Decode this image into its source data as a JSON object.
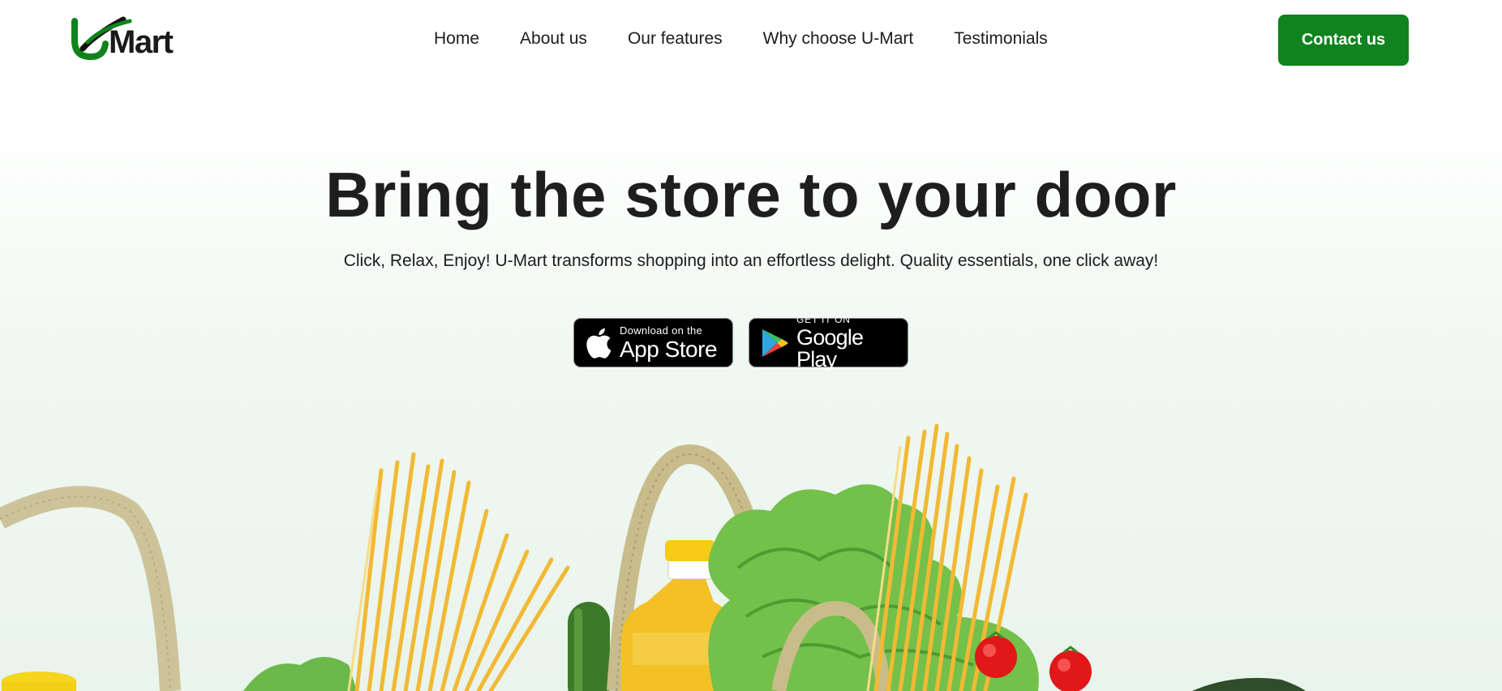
{
  "header": {
    "logo": {
      "text": "Mart",
      "icon": "u-checkmark-icon",
      "brand_color": "#10831f"
    },
    "nav": [
      {
        "label": "Home"
      },
      {
        "label": "About us"
      },
      {
        "label": "Our features"
      },
      {
        "label": "Why choose U-Mart"
      },
      {
        "label": "Testimonials"
      }
    ],
    "contact_label": "Contact us"
  },
  "hero": {
    "title": "Bring the store to your door",
    "subtitle": "Click, Relax, Enjoy! U-Mart transforms shopping into an effortless delight. Quality essentials, one click away!",
    "badges": {
      "app_store": {
        "small": "Download on the",
        "big": "App Store",
        "icon": "apple-icon"
      },
      "google_play": {
        "small": "GET IT ON",
        "big": "Google Play",
        "icon": "google-play-icon"
      }
    }
  },
  "colors": {
    "accent": "#10831f",
    "text": "#1c1c1c",
    "background_tint": "#e9f4ec"
  }
}
